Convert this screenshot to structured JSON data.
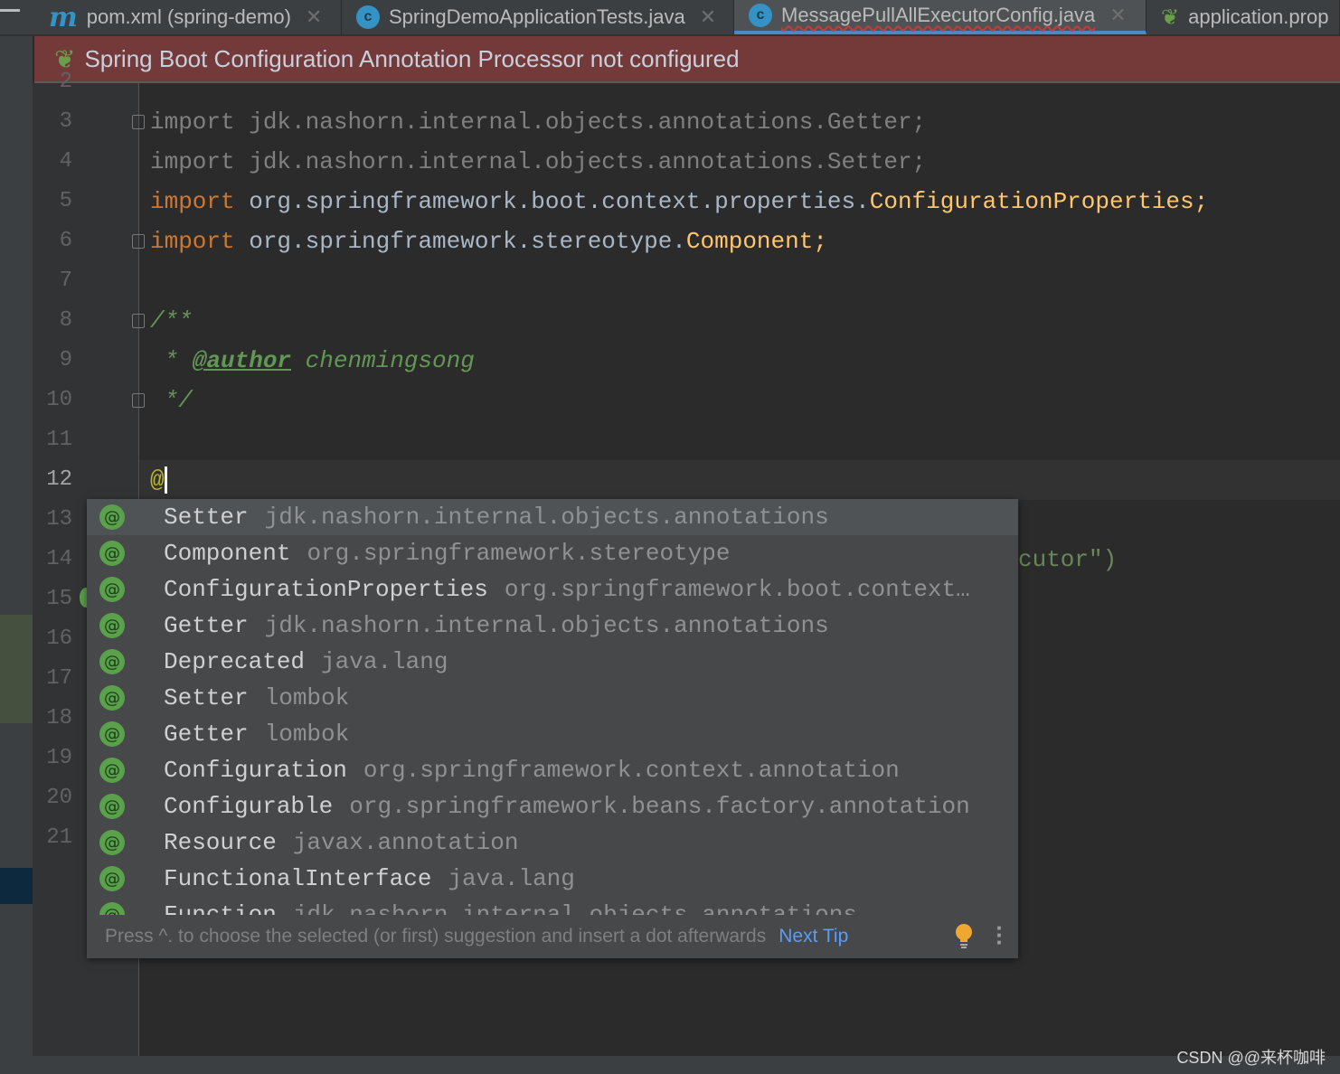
{
  "tabs": [
    {
      "label": "pom.xml (spring-demo)",
      "icon": "maven-icon",
      "active": false
    },
    {
      "label": "SpringDemoApplicationTests.java",
      "icon": "class-icon",
      "active": false
    },
    {
      "label": "MessagePullAllExecutorConfig.java",
      "icon": "class-icon",
      "active": true
    },
    {
      "label": "application.prop",
      "icon": "spring-config-icon",
      "active": false
    }
  ],
  "banner": {
    "text": "Spring Boot Configuration Annotation Processor not configured",
    "icon": "spring-boot-icon"
  },
  "editor": {
    "line_numbers": [
      "2",
      "3",
      "4",
      "5",
      "6",
      "7",
      "8",
      "9",
      "10",
      "11",
      "12",
      "13",
      "14",
      "15",
      "16",
      "17",
      "18",
      "19",
      "20",
      "21"
    ],
    "current_line": "12",
    "lines": {
      "l3": {
        "kw": "import",
        "rest": " jdk.nashorn.internal.objects.annotations.Getter;"
      },
      "l4": {
        "kw": "import",
        "rest": " jdk.nashorn.internal.objects.annotations.Setter;"
      },
      "l5": {
        "kw": "import",
        "pkg": " org.springframework.boot.context.properties.",
        "cls": "ConfigurationProperties;"
      },
      "l6": {
        "kw": "import",
        "pkg": " org.springframework.stereotype.",
        "cls": "Component;"
      },
      "l8": "/**",
      "l9_star": " * ",
      "l9_tag": "@author",
      "l9_name": " chenmingsong",
      "l10": " */",
      "l12": "@",
      "l14_tail": "cutor\")"
    }
  },
  "completion": {
    "items": [
      {
        "name": "Setter",
        "pkg": "jdk.nashorn.internal.objects.annotations"
      },
      {
        "name": "Component",
        "pkg": "org.springframework.stereotype"
      },
      {
        "name": "ConfigurationProperties",
        "pkg": "org.springframework.boot.context…"
      },
      {
        "name": "Getter",
        "pkg": "jdk.nashorn.internal.objects.annotations"
      },
      {
        "name": "Deprecated",
        "pkg": "java.lang"
      },
      {
        "name": "Setter",
        "pkg": "lombok"
      },
      {
        "name": "Getter",
        "pkg": "lombok"
      },
      {
        "name": "Configuration",
        "pkg": "org.springframework.context.annotation"
      },
      {
        "name": "Configurable",
        "pkg": "org.springframework.beans.factory.annotation"
      },
      {
        "name": "Resource",
        "pkg": "javax.annotation"
      },
      {
        "name": "FunctionalInterface",
        "pkg": "java.lang"
      },
      {
        "name": "Function",
        "pkg": "jdk.nashorn.internal.objects.annotations"
      }
    ],
    "icon_glyph": "@",
    "tip": "Press ^. to choose the selected (or first) suggestion and insert a dot afterwards",
    "next_tip": "Next Tip"
  },
  "watermark": "CSDN @@来杯咖啡",
  "colors": {
    "banner": "#743a3a",
    "keyword": "#cc7832",
    "comment": "#629755",
    "accent": "#4a88c7"
  }
}
